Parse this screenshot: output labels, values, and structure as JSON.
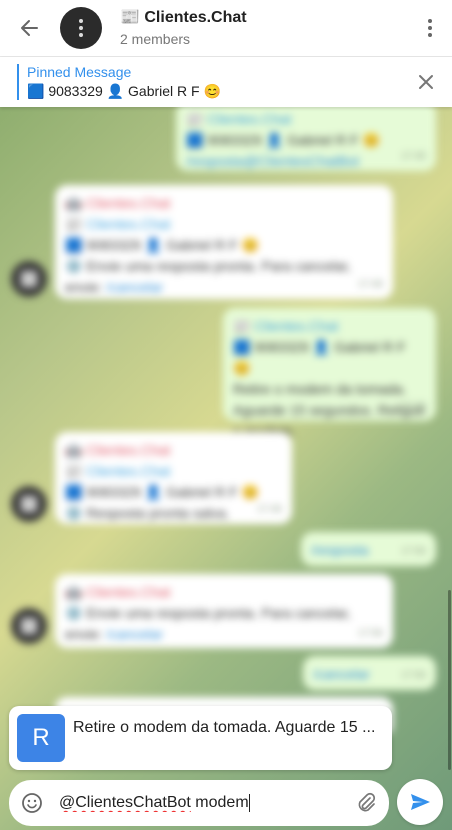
{
  "header": {
    "title": "📰 Clientes.Chat",
    "subtitle": "2 members",
    "back_icon": "arrow-left-icon",
    "menu_icon": "more-vert-icon"
  },
  "pinned": {
    "label": "Pinned Message",
    "text": "🟦 9083329 👤 Gabriel R F 😊",
    "close_icon": "close-icon"
  },
  "messages": {
    "m1": {
      "fwd": "📰 Clientes.Chat",
      "line1": "🟦 9083329 👤 Gabriel R F 😊",
      "link": "/resposta@ClientesChatBot",
      "time": "17:45"
    },
    "m2": {
      "name": "🤖 Clientes.Chat",
      "fwd": "📰 Clientes.Chat",
      "line1": "🟦 9083329 👤 Gabriel R F 😊",
      "text": "⚙️ Envie uma resposta pronta. Para cancelar, envie:",
      "link": "/cancelar",
      "time": "17:46"
    },
    "m3": {
      "fwd": "📰 Clientes.Chat",
      "line1": "🟦 9083329 👤 Gabriel R F 😊",
      "text": "Retire o modem da tomada. Aguarde 15 segundos. Religue o modem.",
      "time": "17:46"
    },
    "m4": {
      "name": "🤖 Clientes.Chat",
      "fwd": "📰 Clientes.Chat",
      "line1": "🟦 9083329 👤 Gabriel R F 😊",
      "text": "⚙️ Resposta pronta salva.",
      "time": "17:46"
    },
    "m5": {
      "link": "/resposta",
      "time": "17:56"
    },
    "m6": {
      "name": "🤖 Clientes.Chat",
      "text": "⚙️ Envie uma resposta pronta. Para cancelar, envie:",
      "link": "/cancelar",
      "time": "17:56"
    },
    "m7": {
      "link": "/cancelar",
      "time": "17:56"
    }
  },
  "suggestion": {
    "icon_letter": "R",
    "text": "Retire o modem da tomada. Aguarde 15 ..."
  },
  "composer": {
    "value_mention": "@ClientesChatBot",
    "value_rest": " modem",
    "emoji_icon": "emoji-icon",
    "attach_icon": "paperclip-icon",
    "send_icon": "send-icon"
  },
  "colors": {
    "accent": "#3390ec",
    "suggestion_icon_bg": "#3d84e6"
  }
}
